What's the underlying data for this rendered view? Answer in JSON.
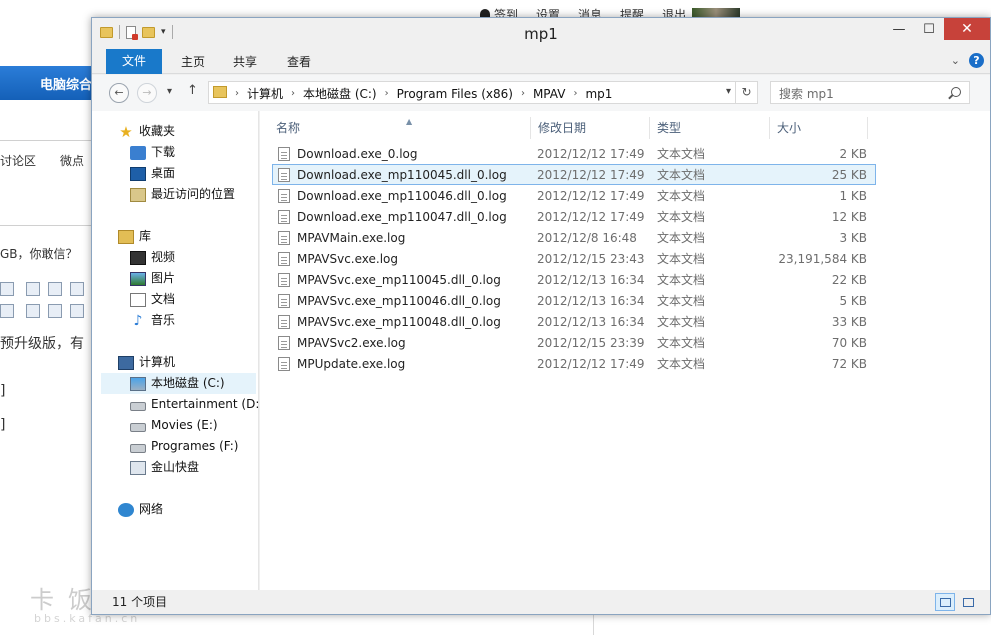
{
  "background": {
    "topbar": [
      "签到",
      "设置",
      "消息",
      "提醒",
      "退出"
    ],
    "nav_label": "电脑综合",
    "texts": [
      "讨论区",
      "微点",
      "GB，你敢信？",
      "预升级版，有"
    ]
  },
  "window": {
    "title": "mp1",
    "controls": {
      "minimize": "—",
      "maximize": "☐",
      "close": "✕"
    }
  },
  "ribbon": {
    "tabs": [
      "文件",
      "主页",
      "共享",
      "查看"
    ],
    "help": "?"
  },
  "address": {
    "crumbs": [
      "计算机",
      "本地磁盘 (C:)",
      "Program Files (x86)",
      "MPAV",
      "mp1"
    ],
    "search_placeholder": "搜索 mp1"
  },
  "nav_pane": {
    "favorites": {
      "label": "收藏夹",
      "items": [
        "下载",
        "桌面",
        "最近访问的位置"
      ]
    },
    "libraries": {
      "label": "库",
      "items": [
        "视频",
        "图片",
        "文档",
        "音乐"
      ]
    },
    "computer": {
      "label": "计算机",
      "items": [
        "本地磁盘 (C:)",
        "Entertainment (D:)",
        "Movies (E:)",
        "Programes (F:)",
        "金山快盘"
      ]
    },
    "network": {
      "label": "网络"
    }
  },
  "columns": {
    "name": "名称",
    "date": "修改日期",
    "type": "类型",
    "size": "大小"
  },
  "files": [
    {
      "name": "Download.exe_0.log",
      "date": "2012/12/12 17:49",
      "type": "文本文档",
      "size": "2 KB"
    },
    {
      "name": "Download.exe_mp110045.dll_0.log",
      "date": "2012/12/12 17:49",
      "type": "文本文档",
      "size": "25 KB"
    },
    {
      "name": "Download.exe_mp110046.dll_0.log",
      "date": "2012/12/12 17:49",
      "type": "文本文档",
      "size": "1 KB"
    },
    {
      "name": "Download.exe_mp110047.dll_0.log",
      "date": "2012/12/12 17:49",
      "type": "文本文档",
      "size": "12 KB"
    },
    {
      "name": "MPAVMain.exe.log",
      "date": "2012/12/8 16:48",
      "type": "文本文档",
      "size": "3 KB"
    },
    {
      "name": "MPAVSvc.exe.log",
      "date": "2012/12/15 23:43",
      "type": "文本文档",
      "size": "23,191,584 KB"
    },
    {
      "name": "MPAVSvc.exe_mp110045.dll_0.log",
      "date": "2012/12/13 16:34",
      "type": "文本文档",
      "size": "22 KB"
    },
    {
      "name": "MPAVSvc.exe_mp110046.dll_0.log",
      "date": "2012/12/13 16:34",
      "type": "文本文档",
      "size": "5 KB"
    },
    {
      "name": "MPAVSvc.exe_mp110048.dll_0.log",
      "date": "2012/12/13 16:34",
      "type": "文本文档",
      "size": "33 KB"
    },
    {
      "name": "MPAVSvc2.exe.log",
      "date": "2012/12/15 23:39",
      "type": "文本文档",
      "size": "70 KB"
    },
    {
      "name": "MPUpdate.exe.log",
      "date": "2012/12/12 17:49",
      "type": "文本文档",
      "size": "72 KB"
    }
  ],
  "selected_file": "Download.exe_mp110045.dll_0.log",
  "selected_drive": "本地磁盘 (C:)",
  "status": "11 个项目",
  "watermark": {
    "main": "卡饭论坛",
    "sub": "bbs.kafan.cn"
  }
}
